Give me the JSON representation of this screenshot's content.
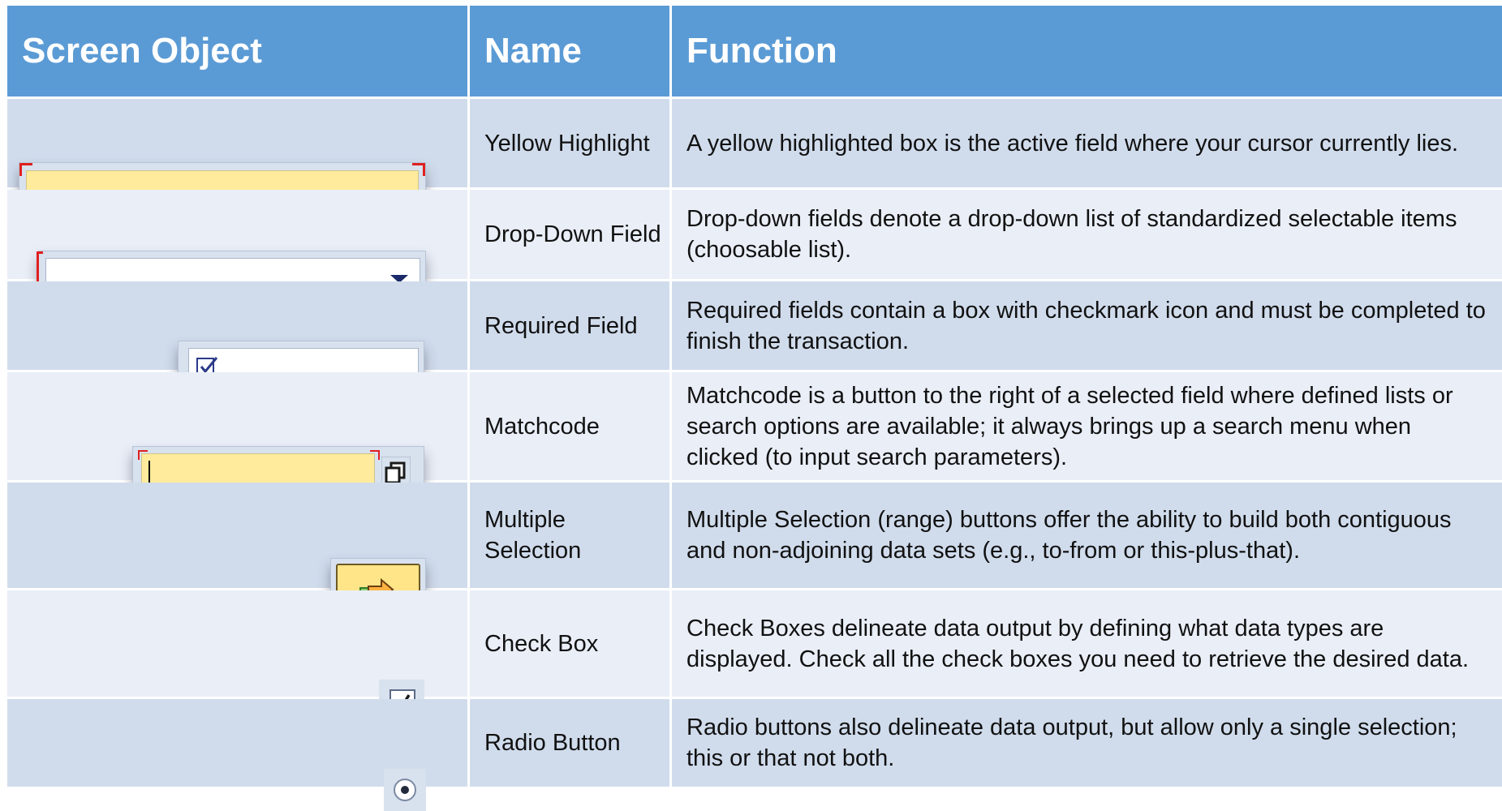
{
  "headers": {
    "screen_object": "Screen Object",
    "name": "Name",
    "function": "Function"
  },
  "rows": [
    {
      "widget": "yellow-highlight-field",
      "name": "Yellow Highlight",
      "function": "A yellow highlighted box is the active field where your cursor currently lies."
    },
    {
      "widget": "drop-down-field",
      "name": "Drop-Down Field",
      "function": "Drop-down fields denote a drop-down list of standardized selectable items (choosable list)."
    },
    {
      "widget": "required-field",
      "name": "Required Field",
      "function": "Required fields contain a box with checkmark icon and must be completed to finish the transaction."
    },
    {
      "widget": "matchcode-field",
      "name": "Matchcode",
      "function": "Matchcode is a button to the right of a selected field where defined lists or search options are available; it always brings up a search menu when clicked (to input search parameters)."
    },
    {
      "widget": "multiple-selection-button",
      "name": "Multiple Selection",
      "function": "Multiple Selection (range) buttons offer the ability to build both contiguous and non-adjoining data sets (e.g., to-from or this-plus-that)."
    },
    {
      "widget": "check-box",
      "name": "Check Box",
      "function": "Check Boxes delineate data output by defining what data types are displayed. Check all the check boxes you need to retrieve the desired data."
    },
    {
      "widget": "radio-button",
      "name": "Radio Button",
      "function": "Radio buttons also delineate data output, but allow only a single selection; this or that not both."
    }
  ],
  "colors": {
    "header_bg": "#5b9bd5",
    "row_dark": "#d0dcec",
    "row_light": "#e9eef7",
    "highlight_yellow": "#ffeb9b",
    "required_red": "#e02020"
  },
  "icons": [
    "dropdown-arrow-icon",
    "required-checkmark-icon",
    "matchcode-icon",
    "multiple-selection-icon",
    "checkmark-icon",
    "radio-dot-icon"
  ]
}
